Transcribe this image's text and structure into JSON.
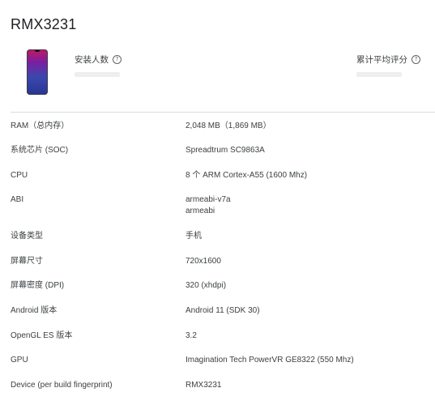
{
  "device": {
    "name": "RMX3231"
  },
  "stats": {
    "installs_label": "安装人数",
    "rating_label": "累计平均评分",
    "help_icon": "help-circle-icon"
  },
  "colors": {
    "phone_gradient": [
      "#c2185b",
      "#7b1fa2",
      "#3949ab",
      "#283593"
    ],
    "divider": "#dadce0",
    "placeholder": "#eeeeee"
  },
  "specs": [
    {
      "label": "RAM（总内存）",
      "values": [
        "2,048 MB（1,869 MB）"
      ]
    },
    {
      "label": "系统芯片 (SOC)",
      "values": [
        "Spreadtrum SC9863A"
      ]
    },
    {
      "label": "CPU",
      "values": [
        "8 个 ARM Cortex-A55 (1600 Mhz)"
      ]
    },
    {
      "label": "ABI",
      "values": [
        "armeabi-v7a",
        "armeabi"
      ]
    },
    {
      "label": "设备类型",
      "values": [
        "手机"
      ]
    },
    {
      "label": "屏幕尺寸",
      "values": [
        "720x1600"
      ]
    },
    {
      "label": "屏幕密度 (DPI)",
      "values": [
        "320 (xhdpi)"
      ]
    },
    {
      "label": "Android 版本",
      "values": [
        "Android 11 (SDK 30)"
      ]
    },
    {
      "label": "OpenGL ES 版本",
      "values": [
        "3.2"
      ]
    },
    {
      "label": "GPU",
      "values": [
        "Imagination Tech PowerVR GE8322 (550 Mhz)"
      ]
    },
    {
      "label": "Device (per build fingerprint)",
      "values": [
        "RMX3231"
      ]
    }
  ]
}
